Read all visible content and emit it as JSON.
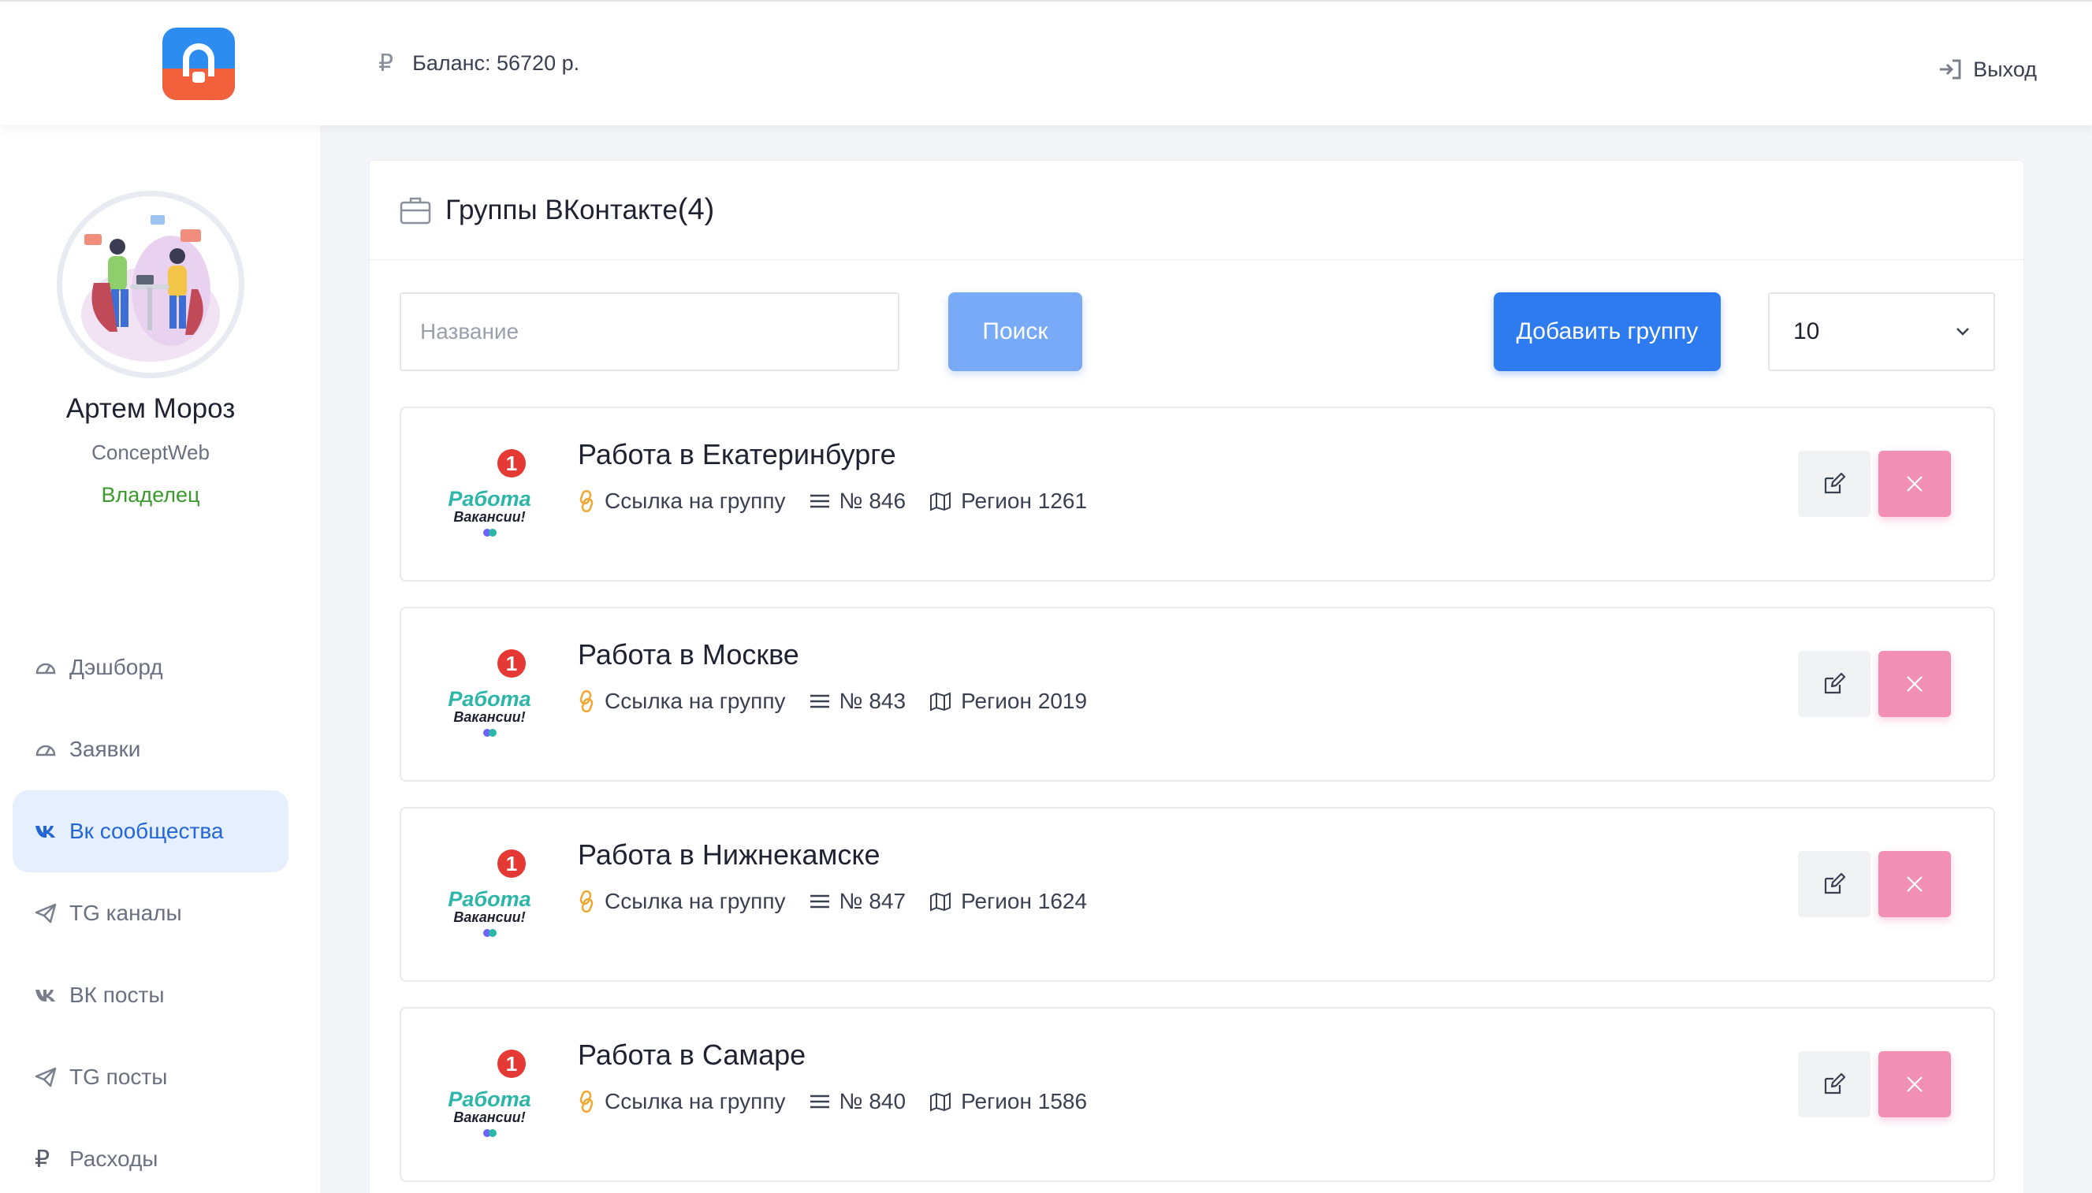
{
  "header": {
    "balance_icon": "ruble-icon",
    "balance_text": "Баланс: 56720 р.",
    "logout_label": "Выход",
    "logout_icon": "sign-out-icon"
  },
  "profile": {
    "name": "Артем Мороз",
    "company": "ConceptWeb",
    "role": "Владелец"
  },
  "sidebar": {
    "items": [
      {
        "label": "Дэшборд",
        "icon": "dashboard-icon",
        "active": false
      },
      {
        "label": "Заявки",
        "icon": "dashboard-icon",
        "active": false
      },
      {
        "label": "Вк сообщества",
        "icon": "vk-icon",
        "active": true
      },
      {
        "label": "TG каналы",
        "icon": "telegram-icon",
        "active": false
      },
      {
        "label": "ВК посты",
        "icon": "vk-icon",
        "active": false
      },
      {
        "label": "TG посты",
        "icon": "telegram-icon",
        "active": false
      },
      {
        "label": "Расходы",
        "icon": "ruble-icon",
        "active": false
      }
    ]
  },
  "main": {
    "title": "Группы ВКонтакте",
    "count": "(4)",
    "search_placeholder": "Название",
    "search_button": "Поиск",
    "add_button": "Добавить группу",
    "per_page": "10",
    "link_label": "Ссылка на группу",
    "groups": [
      {
        "title": "Работа в Екатеринбурге",
        "number": "№ 846",
        "region": "Регион 1261"
      },
      {
        "title": "Работа в Москве",
        "number": "№ 843",
        "region": "Регион 2019"
      },
      {
        "title": "Работа в Нижнекамске",
        "number": "№ 847",
        "region": "Регион 1624"
      },
      {
        "title": "Работа в Самаре",
        "number": "№ 840",
        "region": "Регион 1586"
      }
    ],
    "group_logo": {
      "badge": "1",
      "line1": "Работа",
      "line2": "Вакансии!"
    }
  },
  "colors": {
    "accent": "#2e7bf0",
    "accent_light": "#79aaf7",
    "delete": "#f28fb5",
    "role": "#3a9a2c",
    "link_icon": "#f0a832"
  }
}
